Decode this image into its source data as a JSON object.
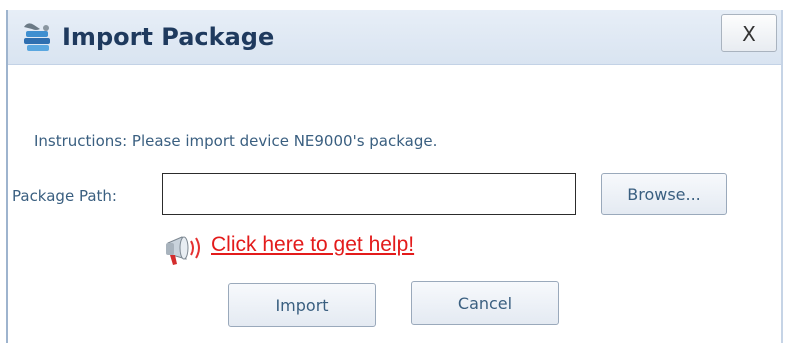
{
  "dialog": {
    "title": "Import Package",
    "close_label": "X"
  },
  "form": {
    "instructions": "Instructions:  Please import device NE9000's package.",
    "path_label": "Package Path:",
    "path_value": "",
    "browse_label": "Browse..."
  },
  "help": {
    "link_text": "Click here to get help!"
  },
  "actions": {
    "import_label": "Import",
    "cancel_label": "Cancel"
  },
  "icons": {
    "title": "package-icon",
    "help": "megaphone-icon"
  },
  "colors": {
    "title_text": "#1f3a5e",
    "label_text": "#3a5f80",
    "help_link": "#e31b1b",
    "titlebar_bg": "#dde7f3"
  }
}
